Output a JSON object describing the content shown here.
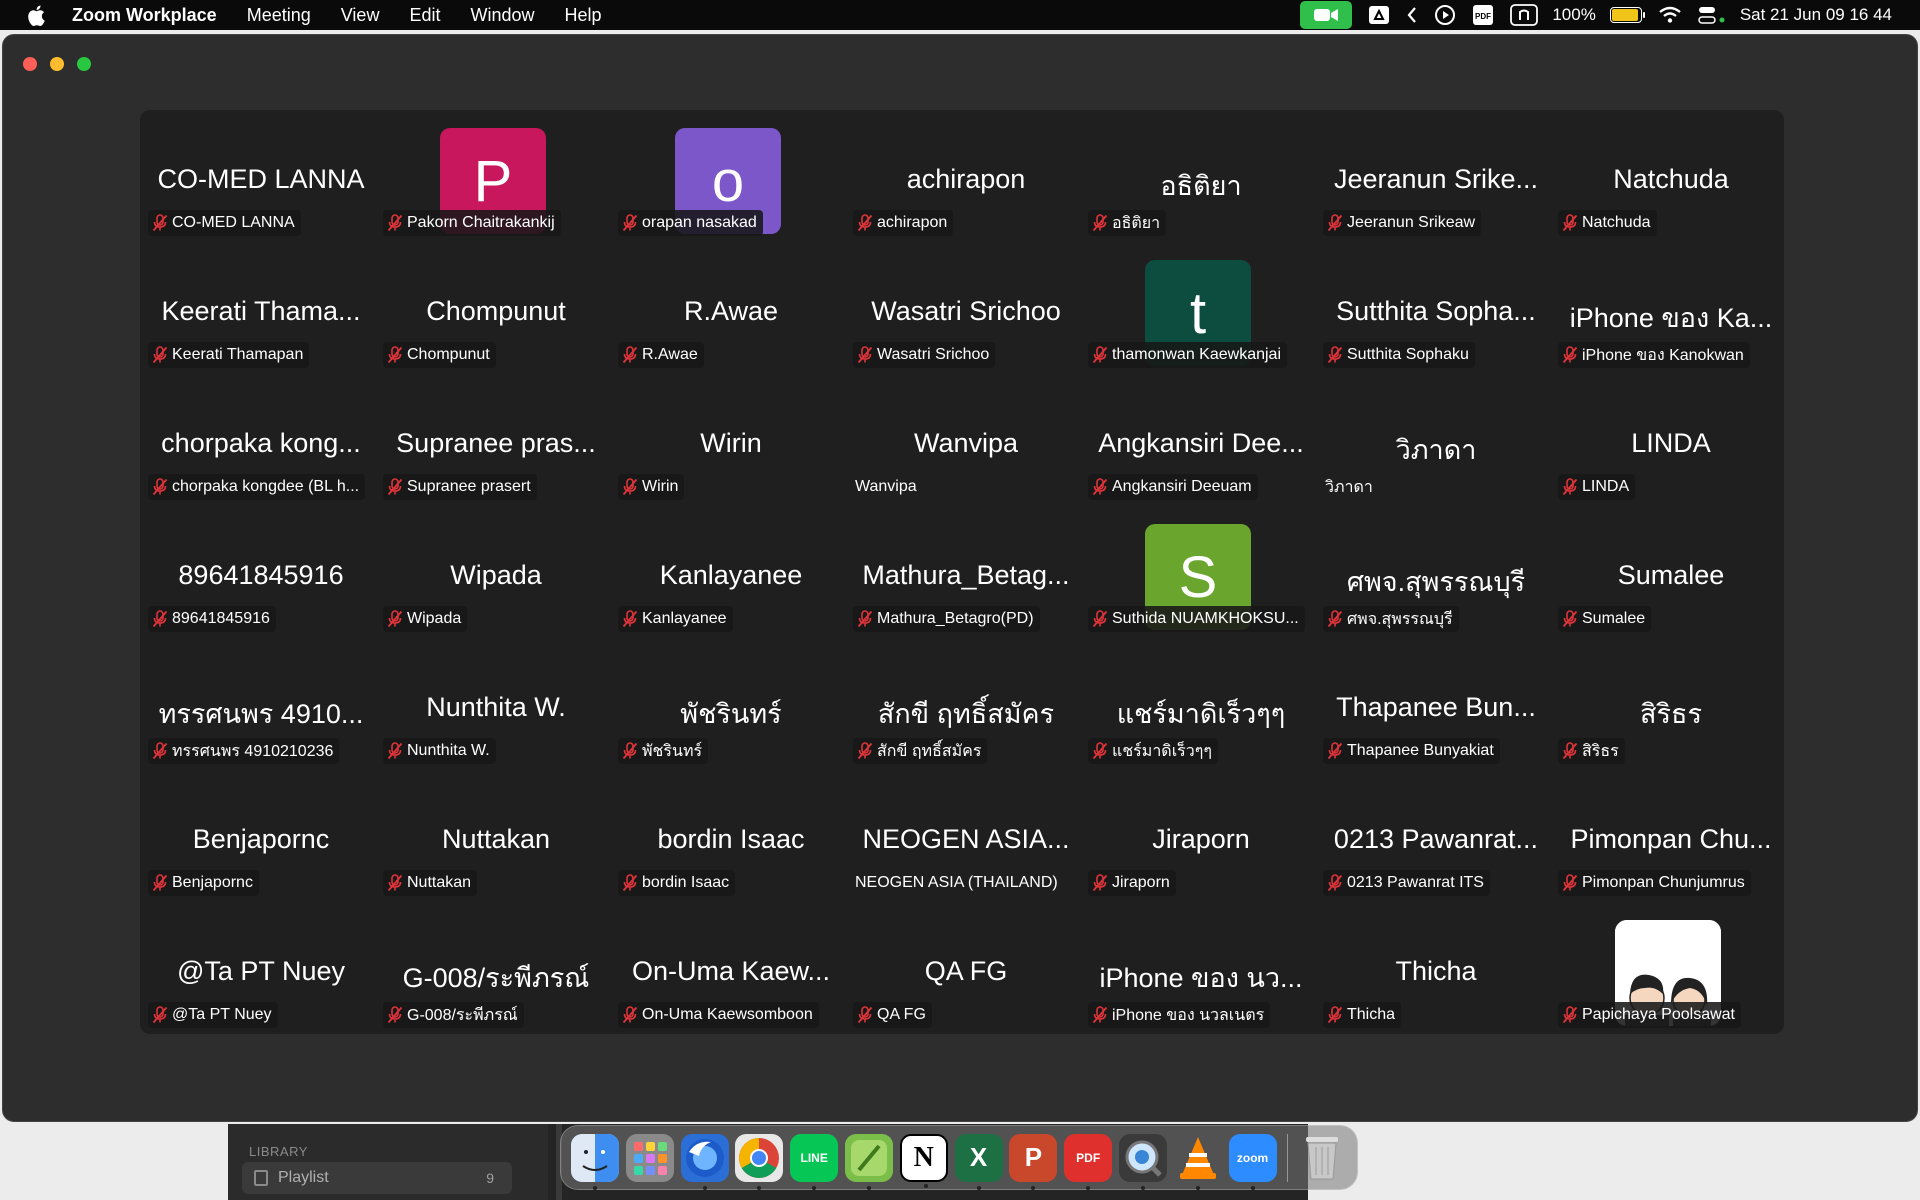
{
  "menubar": {
    "app_name": "Zoom Workplace",
    "items": [
      "Meeting",
      "View",
      "Edit",
      "Window",
      "Help"
    ],
    "battery_percent": "100%",
    "datetime": "Sat 21 Jun  09 16 44",
    "icons": [
      "apple-icon",
      "zoom-video-icon",
      "google-drive-icon",
      "chevron-left-icon",
      "play-circle-icon",
      "pdf-icon",
      "n-icon",
      "battery-icon",
      "wifi-icon",
      "control-center-icon"
    ]
  },
  "gallery": {
    "rows": [
      [
        {
          "display": "CO-MED LANNA",
          "label": "CO-MED LANNA",
          "muted": true
        },
        {
          "display": "",
          "label": "Pakorn Chaitrakankij",
          "muted": true,
          "avatar": "P",
          "avatar_color": "#c8175d"
        },
        {
          "display": "",
          "label": "orapan nasakad",
          "muted": true,
          "avatar": "o",
          "avatar_color": "#7b57c9"
        },
        {
          "display": "achirapon",
          "label": "achirapon",
          "muted": true
        },
        {
          "display": "อธิติยา",
          "label": "อธิติยา",
          "muted": true
        },
        {
          "display": "Jeeranun Srike...",
          "label": "Jeeranun Srikeaw",
          "muted": true
        },
        {
          "display": "Natchuda",
          "label": "Natchuda",
          "muted": true
        }
      ],
      [
        {
          "display": "Keerati Thama...",
          "label": "Keerati Thamapan",
          "muted": true
        },
        {
          "display": "Chompunut",
          "label": "Chompunut",
          "muted": true
        },
        {
          "display": "R.Awae",
          "label": "R.Awae",
          "muted": true
        },
        {
          "display": "Wasatri Srichoo",
          "label": "Wasatri Srichoo",
          "muted": true
        },
        {
          "display": "",
          "label": "thamonwan Kaewkanjai",
          "muted": true,
          "avatar": "t",
          "avatar_color": "#0d4d3f"
        },
        {
          "display": "Sutthita Sopha...",
          "label": "Sutthita Sophaku",
          "muted": true
        },
        {
          "display": "iPhone ของ Ka...",
          "label": "iPhone ของ Kanokwan",
          "muted": true
        }
      ],
      [
        {
          "display": "chorpaka kong...",
          "label": "chorpaka kongdee (BL h...",
          "muted": true
        },
        {
          "display": "Supranee pras...",
          "label": "Supranee prasert",
          "muted": true
        },
        {
          "display": "Wirin",
          "label": "Wirin",
          "muted": true
        },
        {
          "display": "Wanvipa",
          "label": "Wanvipa",
          "muted": false
        },
        {
          "display": "Angkansiri Dee...",
          "label": "Angkansiri Deeuam",
          "muted": true
        },
        {
          "display": "วิภาดา",
          "label": "วิภาดา",
          "muted": false
        },
        {
          "display": "LINDA",
          "label": "LINDA",
          "muted": true
        }
      ],
      [
        {
          "display": "89641845916",
          "label": "89641845916",
          "muted": true
        },
        {
          "display": "Wipada",
          "label": "Wipada",
          "muted": true
        },
        {
          "display": "Kanlayanee",
          "label": "Kanlayanee",
          "muted": true
        },
        {
          "display": "Mathura_Betag...",
          "label": "Mathura_Betagro(PD)",
          "muted": true
        },
        {
          "display": "",
          "label": "Suthida NUAMKHOKSU...",
          "muted": true,
          "avatar": "S",
          "avatar_color": "#6aa52e"
        },
        {
          "display": "ศพจ.สุพรรณบุรี",
          "label": "ศพจ.สุพรรณบุรี",
          "muted": true
        },
        {
          "display": "Sumalee",
          "label": "Sumalee",
          "muted": true
        }
      ],
      [
        {
          "display": "ทรรศนพร 4910...",
          "label": "ทรรศนพร 4910210236",
          "muted": true
        },
        {
          "display": "Nunthita W.",
          "label": "Nunthita W.",
          "muted": true
        },
        {
          "display": "พัชรินทร์",
          "label": "พัชรินทร์",
          "muted": true
        },
        {
          "display": "สักขี ฤทธิ์สมัคร",
          "label": "สักขี ฤทธิ์สมัคร",
          "muted": true
        },
        {
          "display": "แชร์มาดิเร็วๆๆ",
          "label": "แชร์มาดิเร็วๆๆ",
          "muted": true
        },
        {
          "display": "Thapanee Bun...",
          "label": "Thapanee Bunyakiat",
          "muted": true
        },
        {
          "display": "สิริธร",
          "label": "สิริธร",
          "muted": true
        }
      ],
      [
        {
          "display": "Benjapornc",
          "label": "Benjapornc",
          "muted": true
        },
        {
          "display": "Nuttakan",
          "label": "Nuttakan",
          "muted": true
        },
        {
          "display": "bordin Isaac",
          "label": "bordin Isaac",
          "muted": true
        },
        {
          "display": "NEOGEN ASIA...",
          "label": "NEOGEN ASIA (THAILAND)",
          "muted": false
        },
        {
          "display": "Jiraporn",
          "label": "Jiraporn",
          "muted": true
        },
        {
          "display": "0213 Pawanrat...",
          "label": "0213 Pawanrat ITS",
          "muted": true
        },
        {
          "display": "Pimonpan Chu...",
          "label": "Pimonpan Chunjumrus",
          "muted": true
        }
      ],
      [
        {
          "display": "@Ta PT Nuey",
          "label": "@Ta PT Nuey",
          "muted": true
        },
        {
          "display": "G-008/ระพีภรณ์",
          "label": "G-008/ระพีภรณ์",
          "muted": true
        },
        {
          "display": "On-Uma Kaew...",
          "label": "On-Uma Kaewsomboon",
          "muted": true
        },
        {
          "display": "QA FG",
          "label": "QA FG",
          "muted": true
        },
        {
          "display": "iPhone ของ นว...",
          "label": "iPhone ของ นวลเนตร",
          "muted": true
        },
        {
          "display": "Thicha",
          "label": "Thicha",
          "muted": true
        },
        {
          "display": "",
          "label": "Papichaya Poolsawat",
          "muted": true,
          "photo": true
        }
      ]
    ]
  },
  "library": {
    "title": "LIBRARY",
    "playlist_label": "Playlist",
    "playlist_count": "9"
  },
  "dock": {
    "apps": [
      {
        "name": "finder-icon",
        "color": "#3d8ef0",
        "glyph": "",
        "running": true
      },
      {
        "name": "launchpad-icon",
        "color": "#8a8a8a",
        "glyph": "",
        "running": false
      },
      {
        "name": "firefox-icon",
        "color": "#2b6fd6",
        "glyph": "",
        "running": true
      },
      {
        "name": "chrome-icon",
        "color": "#e8e8e8",
        "glyph": "",
        "running": true
      },
      {
        "name": "line-icon",
        "color": "#06c755",
        "glyph": "LINE",
        "running": true
      },
      {
        "name": "notes-app-icon",
        "color": "#7bbf4a",
        "glyph": "",
        "running": true
      },
      {
        "name": "notion-icon",
        "color": "#ffffff",
        "glyph": "N",
        "running": true
      },
      {
        "name": "excel-icon",
        "color": "#1d7044",
        "glyph": "X",
        "running": true
      },
      {
        "name": "powerpoint-icon",
        "color": "#c9472a",
        "glyph": "P",
        "running": true
      },
      {
        "name": "pdf-expert-icon",
        "color": "#e0302e",
        "glyph": "PDF",
        "running": true
      },
      {
        "name": "quicktime-icon",
        "color": "#3a3a3a",
        "glyph": "",
        "running": true
      },
      {
        "name": "vlc-icon",
        "color": "transparent",
        "glyph": "",
        "running": true
      },
      {
        "name": "zoom-icon",
        "color": "#2d8cff",
        "glyph": "zoom",
        "running": true
      }
    ],
    "trash": "trash-icon"
  }
}
